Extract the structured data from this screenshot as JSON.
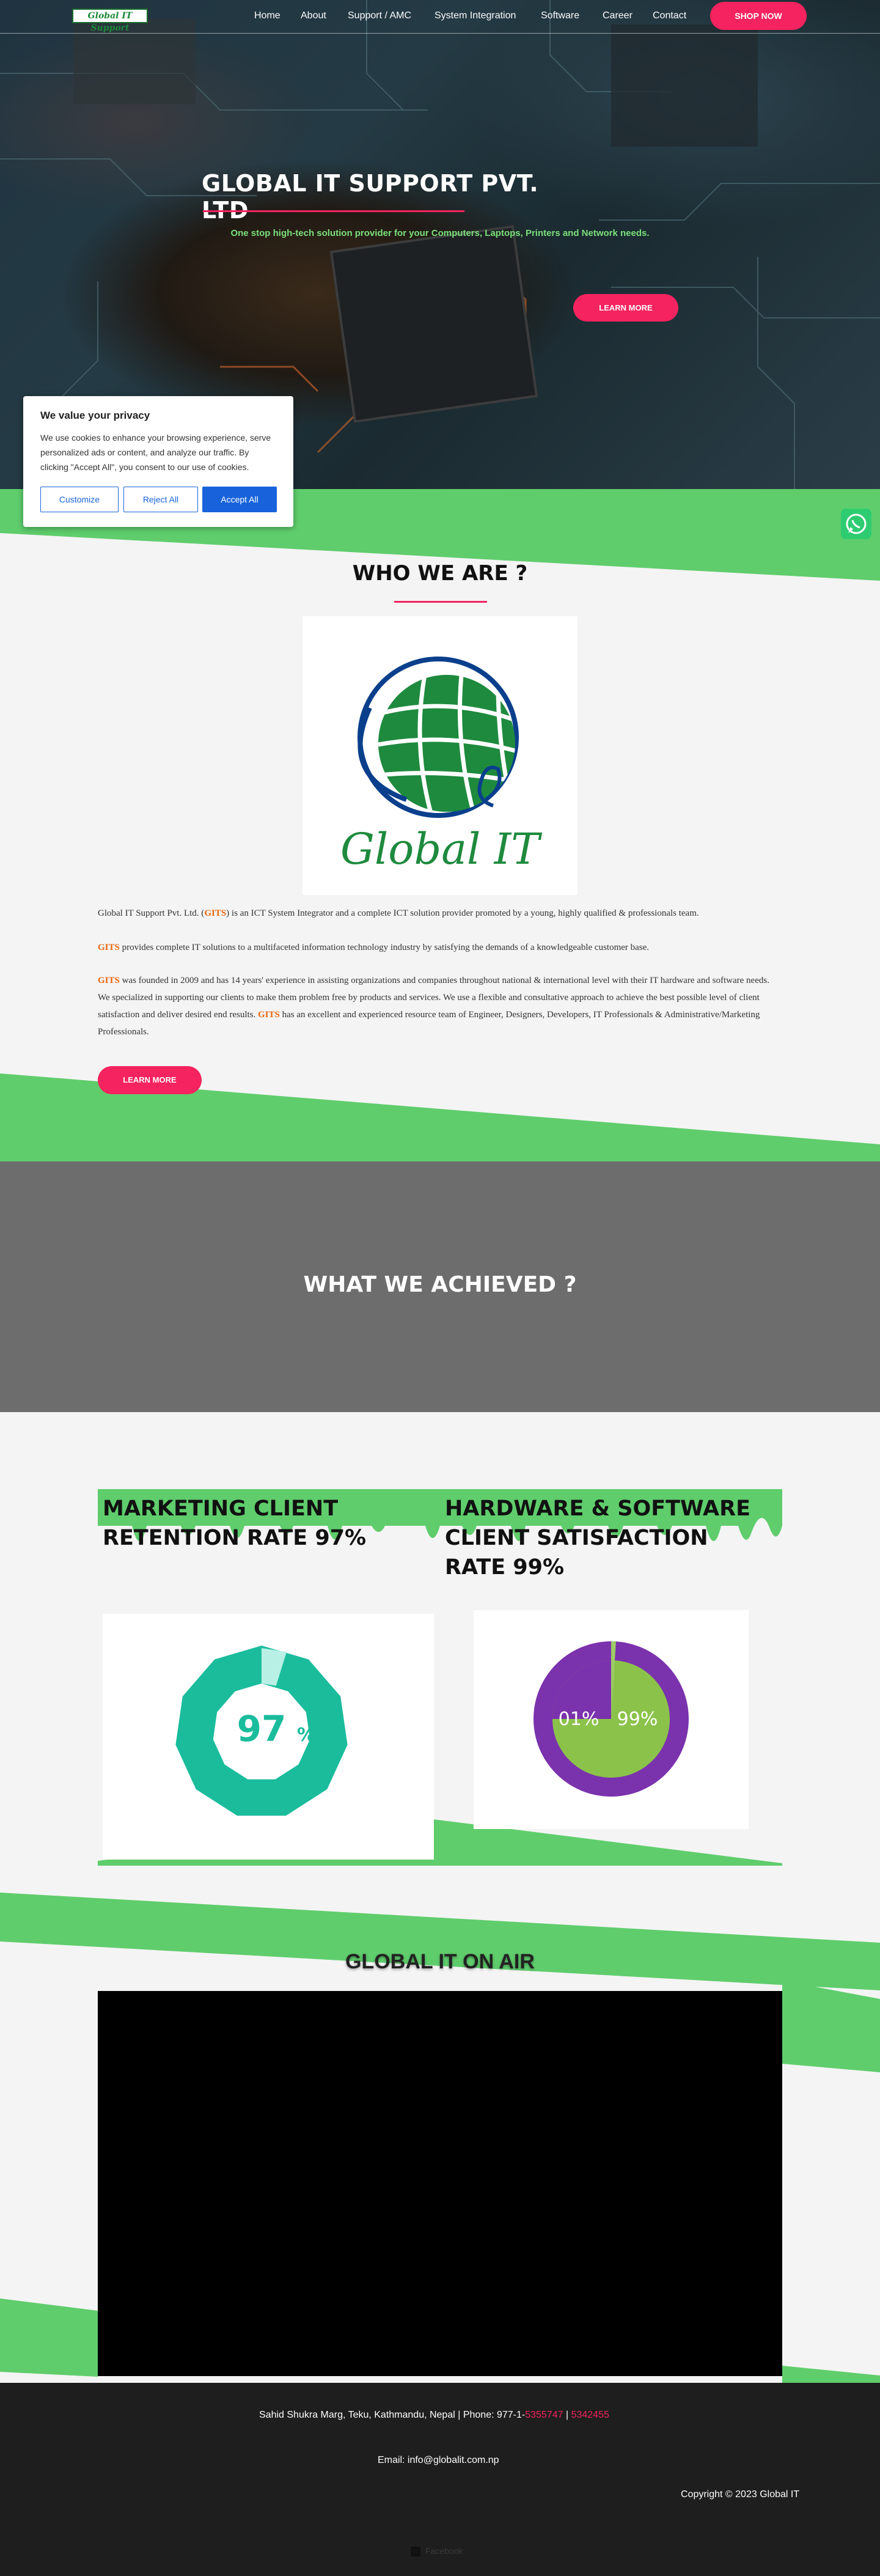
{
  "nav": {
    "logo_text": "Global IT Support",
    "links": [
      "Home",
      "About",
      "Support / AMC",
      "System Integration",
      "Software",
      "Career",
      "Contact"
    ],
    "shop_label": "SHOP NOW"
  },
  "hero": {
    "title": "GLOBAL IT SUPPORT PVT. LTD",
    "subtitle": "One stop high-tech solution provider for your Computers, Laptops, Printers and Network needs.",
    "button": "LEARN MORE"
  },
  "cookie": {
    "title": "We value your privacy",
    "text": "We use cookies to enhance your browsing experience, serve personalized ads or content, and analyze our traffic. By clicking \"Accept All\", you consent to our use of cookies.",
    "customize": "Customize",
    "reject": "Reject All",
    "accept": "Accept All"
  },
  "who": {
    "title": "WHO WE ARE ?",
    "logo_text": "Global IT",
    "p1_a": "Global IT Support Pvt. Ltd. (",
    "p1_brand": "GITS",
    "p1_b": ") is an ICT System Integrator and a complete ICT solution provider promoted by a young, highly qualified & professionals team.",
    "p2_brand": "GITS",
    "p2_b": " provides complete IT solutions to a multifaceted information technology industry by satisfying the demands of a knowledgeable customer base.",
    "p3_brand": "GITS",
    "p3_b": " was founded in 2009 and has 14 years' experience in assisting organizations and companies throughout national & international level with their IT hardware and software needs. We specialized in supporting our clients to make them problem free by products and services. We use a flexible and consultative approach to achieve the best possible level of client satisfaction and deliver desired end results. ",
    "p3_brand2": "GITS",
    "p3_c": " has an excellent and experienced resource team of Engineer, Designers, Developers, IT Professionals & Administrative/Marketing Professionals.",
    "button": "LEARN MORE"
  },
  "achieved": {
    "title": "WHAT WE ACHIEVED ?",
    "stat1_title": "MARKETING CLIENT RETENTION RATE 97%",
    "stat1_value": "97",
    "stat1_unit": "%",
    "stat1_fraction": 0.97,
    "stat2_title": "HARDWARE & SOFTWARE CLIENT SATISFACTION RATE 99%",
    "stat2_small": "01%",
    "stat2_big": "99%",
    "stat2_fraction": 0.99
  },
  "air": {
    "title": "GLOBAL IT ON AIR"
  },
  "footer": {
    "address": "Sahid Shukra Marg, Teku, Kathmandu, Nepal | Phone: 977-1-",
    "phone1": "5355747",
    "sep": " | ",
    "phone2": "5342455",
    "email": "Email: info@globalit.com.np",
    "copyright": "Copyright © 2023 Global IT",
    "facebook": "Facebook"
  },
  "colors": {
    "accent": "#f5235f",
    "green": "#5fcd6c",
    "footer_bg": "#1e1e1e"
  }
}
